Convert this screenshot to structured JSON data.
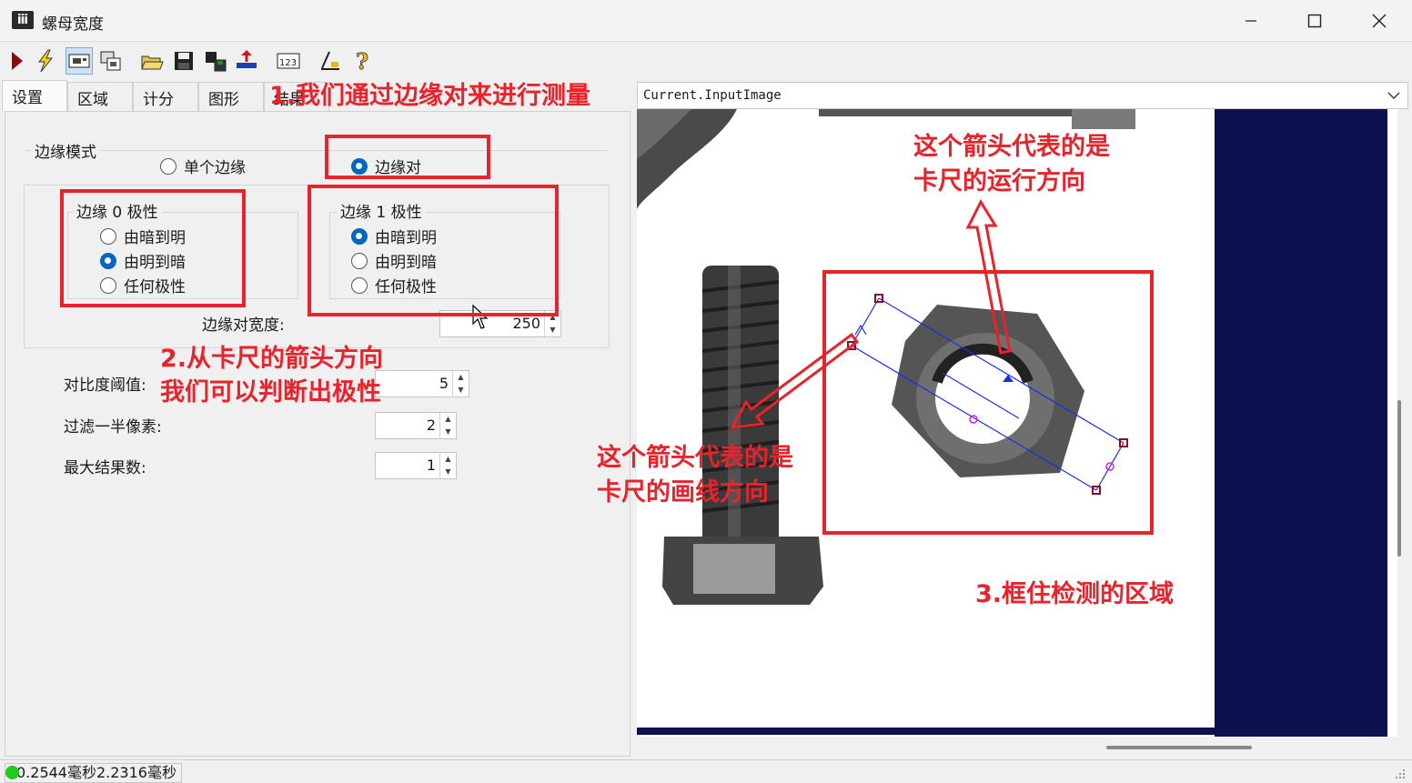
{
  "window": {
    "title": "螺母宽度"
  },
  "tabs": [
    "设置",
    "区域",
    "计分",
    "图形",
    "结果"
  ],
  "edge_mode": {
    "label": "边缘模式",
    "option_single": "单个边缘",
    "option_pair": "边缘对",
    "selected": "边缘对"
  },
  "edge0": {
    "label": "边缘 0 极性",
    "options": [
      "由暗到明",
      "由明到暗",
      "任何极性"
    ],
    "selected": "由明到暗"
  },
  "edge1": {
    "label": "边缘 1 极性",
    "options": [
      "由暗到明",
      "由明到暗",
      "任何极性"
    ],
    "selected": "由暗到明"
  },
  "fields": {
    "edge_pair_width": {
      "label": "边缘对宽度:",
      "value": "250"
    },
    "contrast_threshold": {
      "label": "对比度阈值:",
      "value": "5"
    },
    "filter_half_pixels": {
      "label": "过滤一半像素:",
      "value": "2"
    },
    "max_results": {
      "label": "最大结果数:",
      "value": "1"
    }
  },
  "image_dropdown": {
    "value": "Current.InputImage"
  },
  "annotations": {
    "note1": "1.我们通过边缘对来进行测量",
    "note2_line1": "2.从卡尺的箭头方向",
    "note2_line2": "我们可以判断出极性",
    "note3": "3.框住检测的区域",
    "arrow_run_line1": "这个箭头代表的是",
    "arrow_run_line2": "卡尺的运行方向",
    "arrow_draw_line1": "这个箭头代表的是",
    "arrow_draw_line2": "卡尺的画线方向"
  },
  "status": {
    "text": "0.2544毫秒2.2316毫秒",
    "led_color": "#1ecb1e"
  },
  "colors": {
    "annotation_red": "#e8232c",
    "caliper_blue": "#1a2ee8",
    "handle_maroon": "#8a0a2a",
    "navy_background": "#0c1150"
  },
  "toolbar_icons": [
    "run-icon",
    "lightning-icon",
    "image-view-icon",
    "copy-image-icon",
    "open-folder-icon",
    "save-icon",
    "save-as-icon",
    "load-icon",
    "numbers-icon",
    "measure-icon",
    "help-icon"
  ]
}
